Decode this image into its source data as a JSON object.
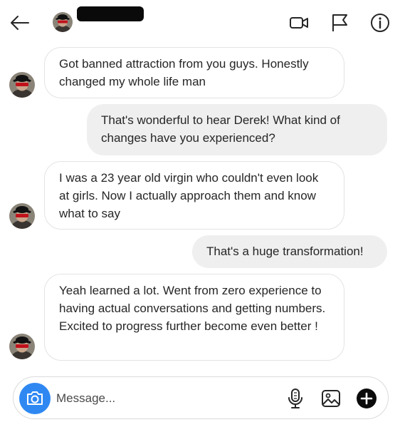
{
  "header": {
    "username": "redacted"
  },
  "messages": [
    {
      "sender": "them",
      "text": "Got banned attraction from you guys. Honestly changed my whole life man"
    },
    {
      "sender": "me",
      "text": "That's wonderful to hear Derek! What kind of changes have you experienced?"
    },
    {
      "sender": "them",
      "text": "I was a 23 year old virgin who couldn't even look at girls. Now I actually approach them and know what to say"
    },
    {
      "sender": "me",
      "text": "That's a huge transformation!"
    },
    {
      "sender": "them",
      "text": "Yeah learned a lot. Went from zero experience to having actual conversations and getting numbers. Excited to progress further become even better !"
    }
  ],
  "composer": {
    "placeholder": "Message..."
  },
  "colors": {
    "accent": "#2f88f2",
    "incoming_border": "#e3e3e3",
    "outgoing_bg": "#efefef"
  },
  "icons": {
    "back": "arrow-left-icon",
    "video": "video-camera-icon",
    "report": "flag-icon",
    "info": "info-icon",
    "camera": "camera-icon",
    "mic": "microphone-icon",
    "gallery": "image-icon",
    "add": "plus-circle-icon"
  }
}
